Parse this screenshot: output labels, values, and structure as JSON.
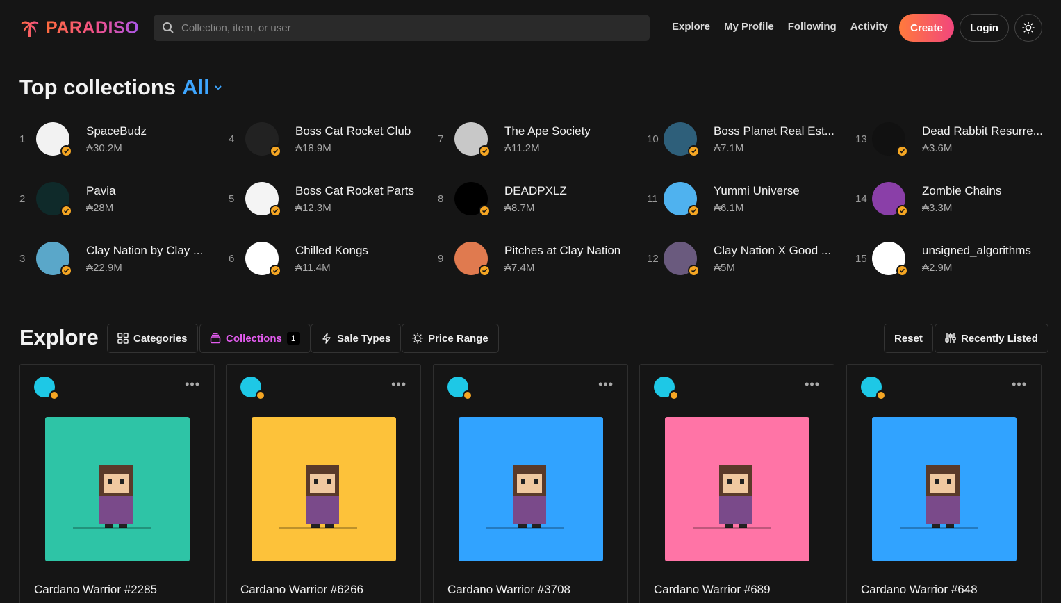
{
  "header": {
    "logo_text": "PARADISO",
    "search_placeholder": "Collection, item, or user",
    "nav": [
      "Explore",
      "My Profile",
      "Following",
      "Activity"
    ],
    "create_label": "Create",
    "login_label": "Login",
    "theme_icon": "sun-icon",
    "brand_gradient": [
      "#ff6b3d",
      "#f0508c",
      "#a957e8"
    ]
  },
  "top_collections": {
    "title": "Top collections",
    "filter": "All",
    "items": [
      {
        "rank": "1",
        "name": "SpaceBudz",
        "volume": "₳30.2M",
        "color": "#f2f2f2"
      },
      {
        "rank": "2",
        "name": "Pavia",
        "volume": "₳28M",
        "color": "#0f2a2a"
      },
      {
        "rank": "3",
        "name": "Clay Nation by Clay ...",
        "volume": "₳22.9M",
        "color": "#5aa7c9"
      },
      {
        "rank": "4",
        "name": "Boss Cat Rocket Club",
        "volume": "₳18.9M",
        "color": "#222222"
      },
      {
        "rank": "5",
        "name": "Boss Cat Rocket Parts",
        "volume": "₳12.3M",
        "color": "#f4f4f4"
      },
      {
        "rank": "6",
        "name": "Chilled Kongs",
        "volume": "₳11.4M",
        "color": "#ffffff"
      },
      {
        "rank": "7",
        "name": "The Ape Society",
        "volume": "₳11.2M",
        "color": "#c8c8c8"
      },
      {
        "rank": "8",
        "name": "DEADPXLZ",
        "volume": "₳8.7M",
        "color": "#000000"
      },
      {
        "rank": "9",
        "name": "Pitches at Clay Nation",
        "volume": "₳7.4M",
        "color": "#e07a4f"
      },
      {
        "rank": "10",
        "name": "Boss Planet Real Est...",
        "volume": "₳7.1M",
        "color": "#2e5f7a"
      },
      {
        "rank": "11",
        "name": "Yummi Universe",
        "volume": "₳6.1M",
        "color": "#4fb2ef"
      },
      {
        "rank": "12",
        "name": "Clay Nation X Good ...",
        "volume": "₳5M",
        "color": "#6a5a7e"
      },
      {
        "rank": "13",
        "name": "Dead Rabbit Resurre...",
        "volume": "₳3.6M",
        "color": "#111111"
      },
      {
        "rank": "14",
        "name": "Zombie Chains",
        "volume": "₳3.3M",
        "color": "#8a3fa8"
      },
      {
        "rank": "15",
        "name": "unsigned_algorithms",
        "volume": "₳2.9M",
        "color": "#ffffff"
      }
    ]
  },
  "explore": {
    "title": "Explore",
    "filters": {
      "categories": "Categories",
      "collections": "Collections",
      "collections_count": "1",
      "sale_types": "Sale Types",
      "price_range": "Price Range",
      "reset": "Reset",
      "sort": "Recently Listed"
    },
    "cards": [
      {
        "title": "Cardano Warrior #2285",
        "bg": "#2ec4a6"
      },
      {
        "title": "Cardano Warrior #6266",
        "bg": "#fdc23a"
      },
      {
        "title": "Cardano Warrior #3708",
        "bg": "#31a3ff"
      },
      {
        "title": "Cardano Warrior #689",
        "bg": "#ff74a6"
      },
      {
        "title": "Cardano Warrior #648",
        "bg": "#31a3ff"
      }
    ],
    "card_menu": "•••"
  }
}
